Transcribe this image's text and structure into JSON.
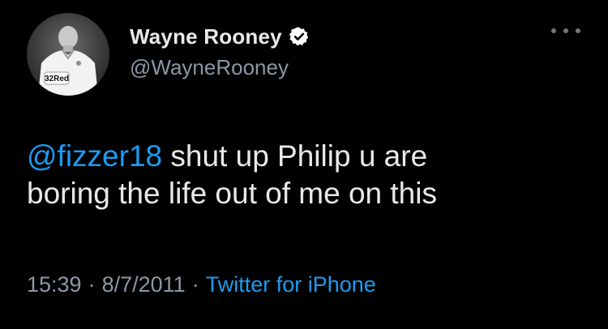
{
  "tweet": {
    "author": {
      "display_name": "Wayne Rooney",
      "handle": "@WayneRooney",
      "verified": true,
      "avatar_icon": "profile-photo-avatar",
      "avatar_shirt_text": "32Red"
    },
    "more_icon": "ellipsis-icon",
    "text": {
      "mention": "@fizzer18",
      "body_line1": " shut up Philip u are",
      "body_line2": "boring the life out of me on this"
    },
    "meta": {
      "time": "15:39",
      "separator1": "·",
      "date": "8/7/2011",
      "separator2": "·",
      "source": "Twitter for iPhone"
    }
  },
  "colors": {
    "background": "#000000",
    "text": "#e7e9ea",
    "secondary": "#8b98a5",
    "accent": "#1d9bf0"
  }
}
